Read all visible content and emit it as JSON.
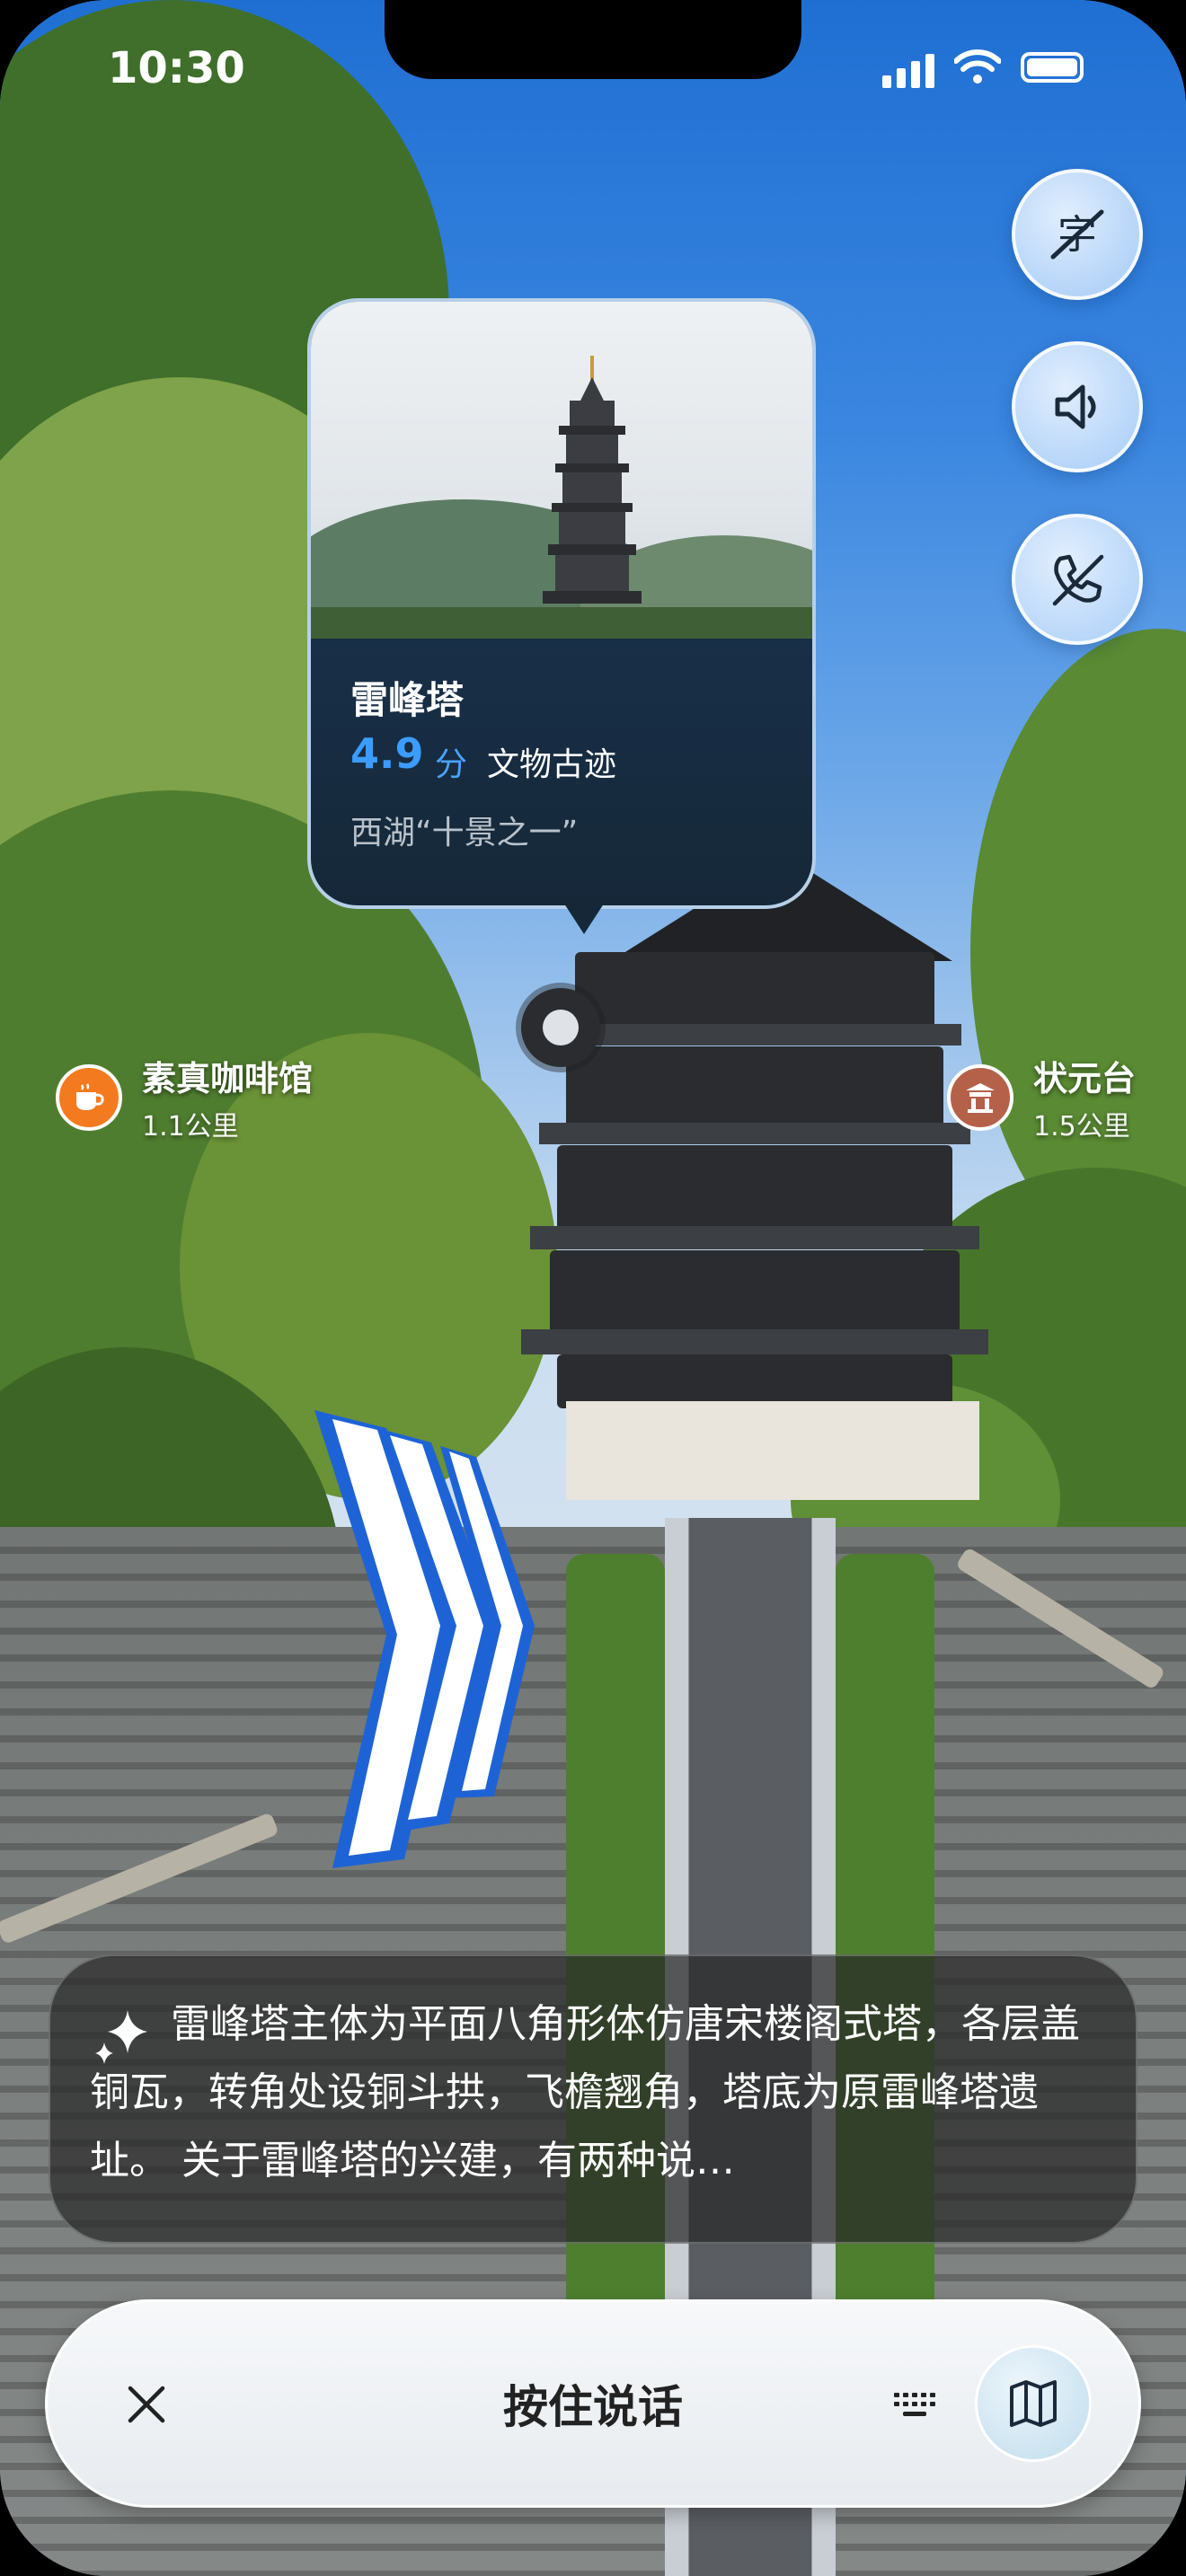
{
  "status_bar": {
    "time": "10:30"
  },
  "controls": {
    "subtitles_icon": "subtitles-off-icon",
    "sound_icon": "speaker-icon",
    "call_icon": "phone-off-icon"
  },
  "poi_card": {
    "title": "雷峰塔",
    "rating": "4.9",
    "rating_unit": "分",
    "category": "文物古迹",
    "description": "西湖“十景之一”",
    "accent": "#3b9cff"
  },
  "nearby": [
    {
      "name": "素真咖啡馆",
      "distance": "1.1公里",
      "icon": "coffee-icon",
      "color": "#f47a1f"
    },
    {
      "name": "状元台",
      "distance": "1.5公里",
      "icon": "pavilion-icon",
      "color": "#b5614a"
    }
  ],
  "narration": {
    "text": "雷峰塔主体为平面八角形体仿唐宋楼阁式塔，各层盖铜瓦，转角处设铜斗拱，飞檐翘角，塔底为原雷峰塔遗址。 关于雷峰塔的兴建，有两种说…"
  },
  "voice_bar": {
    "label": "按住说话",
    "close_icon": "close-icon",
    "keyboard_icon": "keyboard-icon",
    "map_icon": "map-icon"
  }
}
